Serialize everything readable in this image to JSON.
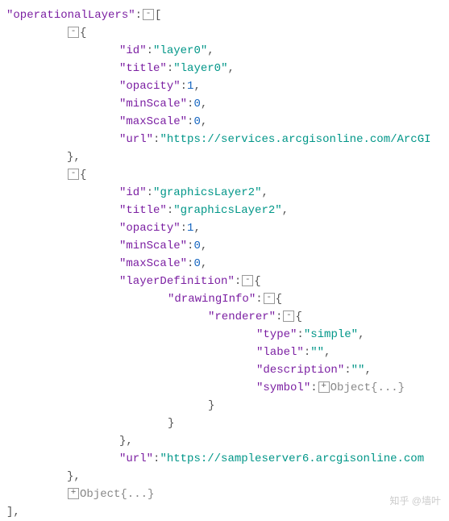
{
  "rootKey": "operationalLayers",
  "layer0": {
    "keys": {
      "id": "id",
      "title": "title",
      "opacity": "opacity",
      "minScale": "minScale",
      "maxScale": "maxScale",
      "url": "url"
    },
    "vals": {
      "id": "layer0",
      "title": "layer0",
      "opacity": "1",
      "minScale": "0",
      "maxScale": "0",
      "url": "https://services.arcgisonline.com/ArcGI"
    }
  },
  "layer1": {
    "keys": {
      "id": "id",
      "title": "title",
      "opacity": "opacity",
      "minScale": "minScale",
      "maxScale": "maxScale",
      "layerDefinition": "layerDefinition",
      "drawingInfo": "drawingInfo",
      "renderer": "renderer",
      "type": "type",
      "label": "label",
      "description": "description",
      "symbol": "symbol",
      "url": "url"
    },
    "vals": {
      "id": "graphicsLayer2",
      "title": "graphicsLayer2",
      "opacity": "1",
      "minScale": "0",
      "maxScale": "0",
      "type": "simple",
      "label": "",
      "description": "",
      "url": "https://sampleserver6.arcgisonline.com"
    }
  },
  "objectPlaceholder": "Object{...}",
  "watermark": "知乎 @墙叶"
}
